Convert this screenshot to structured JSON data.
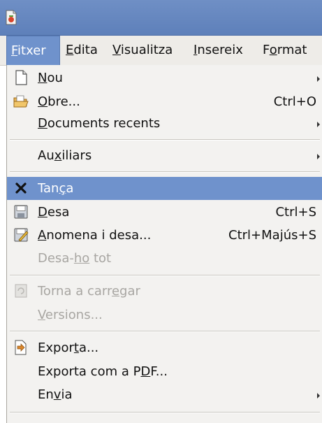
{
  "menubar": [
    {
      "pre": "",
      "key": "F",
      "post": "itxer",
      "active": true
    },
    {
      "pre": "",
      "key": "E",
      "post": "dita"
    },
    {
      "pre": "",
      "key": "V",
      "post": "isualitza"
    },
    {
      "pre": "",
      "key": "I",
      "post": "nsereix"
    },
    {
      "pre": "F",
      "key": "o",
      "post": "rmat"
    }
  ],
  "menu": {
    "items": [
      {
        "pre": "",
        "key": "N",
        "post": "ou",
        "icon": "new-document-icon",
        "submenu": true
      },
      {
        "pre": "",
        "key": "O",
        "post": "bre...",
        "icon": "open-folder-icon",
        "shortcut": "Ctrl+O"
      },
      {
        "pre": "",
        "key": "D",
        "post": "ocuments recents",
        "submenu": true
      },
      {
        "pre": "Au",
        "key": "x",
        "post": "iliars",
        "submenu": true
      },
      {
        "pre": "Tan",
        "key": "ç",
        "post": "a",
        "icon": "close-x-icon",
        "highlight": true
      },
      {
        "pre": "",
        "key": "D",
        "post": "esa",
        "icon": "save-icon",
        "shortcut": "Ctrl+S"
      },
      {
        "pre": "",
        "key": "A",
        "post": "nomena i desa...",
        "icon": "save-as-icon",
        "shortcut": "Ctrl+Majús+S"
      },
      {
        "pre": "Desa-",
        "key": "ho",
        "post": " tot",
        "disabled": true
      },
      {
        "pre": "Torna a carr",
        "key": "e",
        "post": "gar",
        "icon": "reload-icon",
        "disabled": true
      },
      {
        "pre": "",
        "key": "V",
        "post": "ersions...",
        "disabled": true
      },
      {
        "pre": "Expor",
        "key": "t",
        "post": "a...",
        "icon": "export-icon"
      },
      {
        "pre": "Exporta com a P",
        "key": "D",
        "post": "F..."
      },
      {
        "pre": "En",
        "key": "v",
        "post": "ia",
        "submenu": true
      }
    ]
  }
}
